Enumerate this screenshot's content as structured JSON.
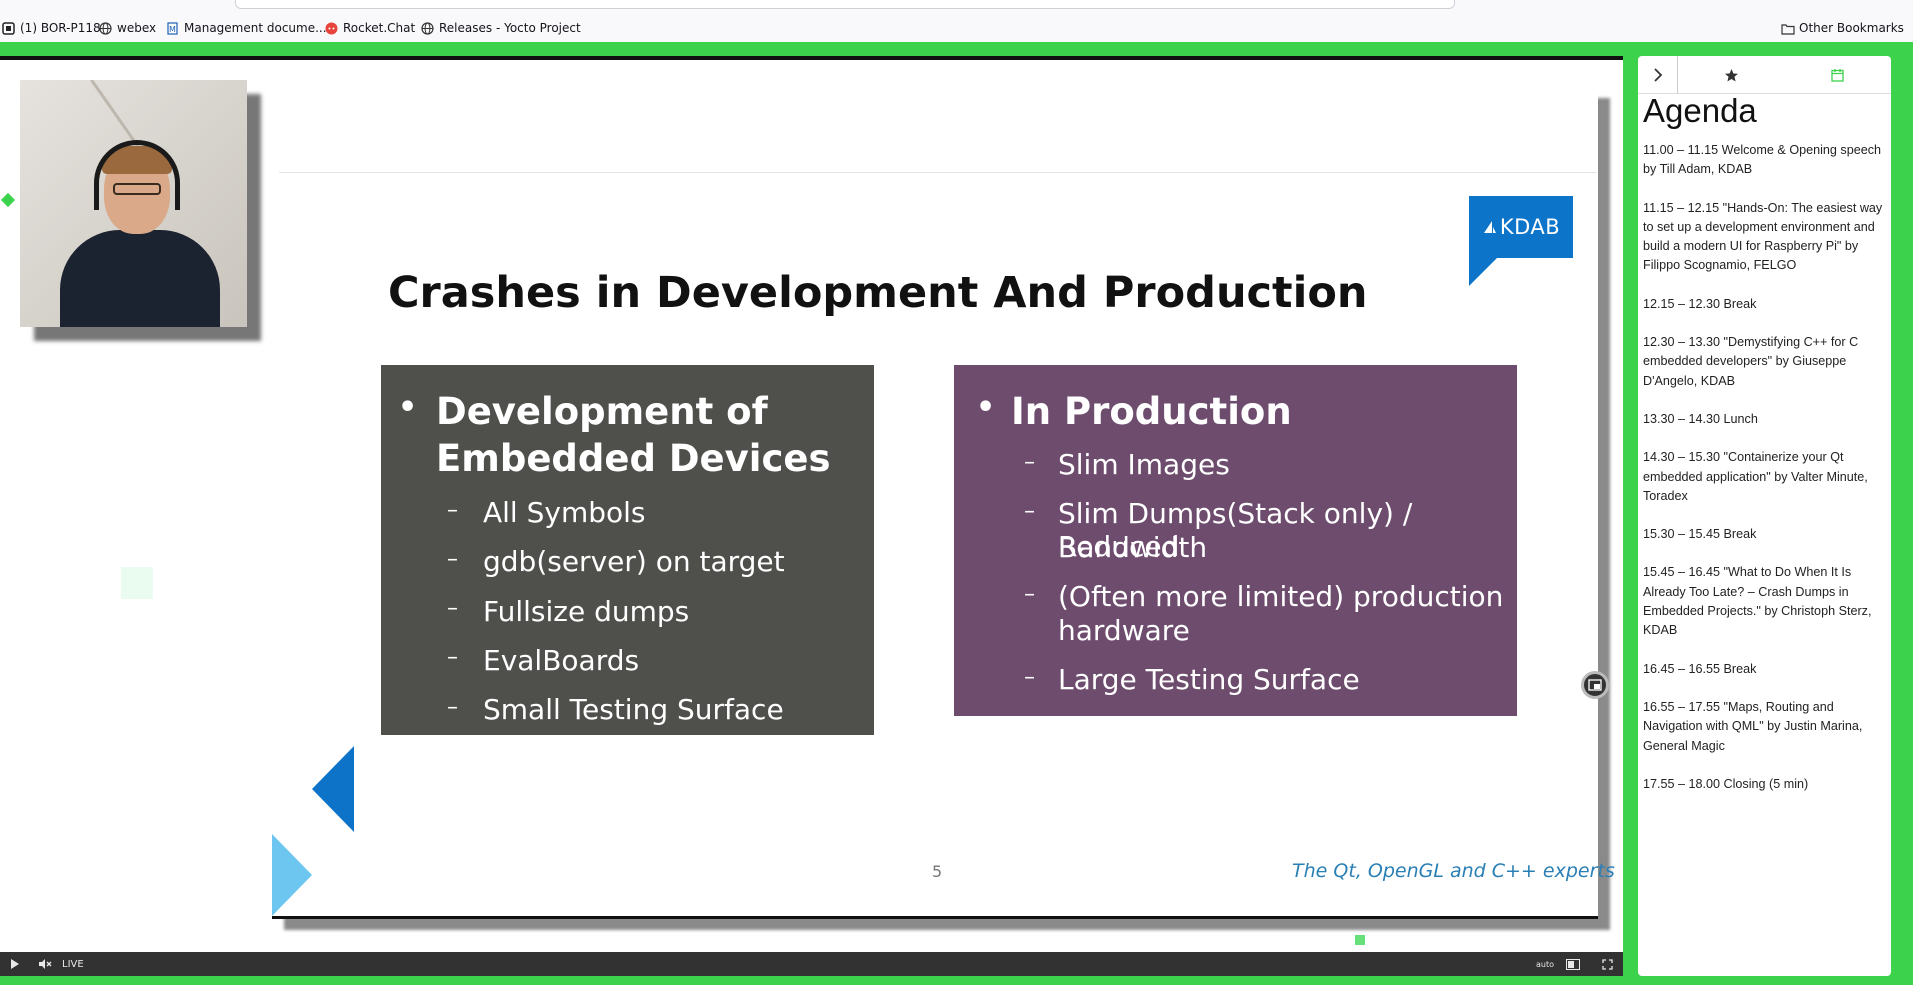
{
  "browser": {
    "bookmarks": [
      {
        "label": "(1) BOR-P118",
        "icon": "tab-icon"
      },
      {
        "label": "webex",
        "icon": "globe-icon"
      },
      {
        "label": "Management docume...",
        "icon": "document-icon"
      },
      {
        "label": "Rocket.Chat",
        "icon": "rocketchat-icon"
      },
      {
        "label": "Releases - Yocto Project",
        "icon": "globe-icon"
      }
    ],
    "other_bookmarks": "Other Bookmarks"
  },
  "slide": {
    "logo": "KDAB",
    "title": "Crashes in Development And Production",
    "left_box": {
      "heading_line1": "Development of",
      "heading_line2": "Embedded Devices",
      "items": [
        "All Symbols",
        "gdb(server) on target",
        "Fullsize dumps",
        "EvalBoards",
        "Small Testing Surface"
      ]
    },
    "right_box": {
      "heading": "In Production",
      "items": [
        {
          "line1": "Slim Images",
          "line2": ""
        },
        {
          "line1": "Slim Dumps(Stack only)  / Reduced",
          "line2": "Bandwidth"
        },
        {
          "line1": "(Often more limited) production",
          "line2": "hardware"
        },
        {
          "line1": "Large Testing Surface",
          "line2": ""
        }
      ]
    },
    "bullet": "•",
    "dash": "–",
    "page_number": "5",
    "tagline": "The Qt, OpenGL and C++ experts"
  },
  "player": {
    "live_label": "LIVE",
    "quality_label": "auto"
  },
  "panel": {
    "title": "Agenda",
    "items": [
      "11.00 – 11.15 Welcome & Opening speech by Till Adam, KDAB",
      "11.15 – 12.15 \"Hands-On: The easiest way to set up a development environment and build a modern UI for Raspberry Pi\" by Filippo Scognamio, FELGO",
      "12.15 – 12.30 Break",
      "12.30 – 13.30 \"Demystifying C++ for C embedded developers\" by Giuseppe D'Angelo, KDAB",
      "13.30 – 14.30 Lunch",
      "14.30 – 15.30 \"Containerize your Qt embedded application\" by Valter Minute, Toradex",
      "15.30 – 15.45 Break",
      "15.45 – 16.45 \"What to Do When It Is Already Too Late? – Crash Dumps in Embedded Projects.\" by Christoph Sterz, KDAB",
      "16.45 – 16.55 Break",
      "16.55 – 17.55 \"Maps, Routing and Navigation with QML\" by Justin Marina, General Magic",
      "17.55 – 18.00 Closing (5 min)"
    ]
  },
  "colors": {
    "frame_green": "#3cd24b",
    "kdab_blue": "#0c74c9",
    "left_box": "#4f504c",
    "right_box": "#6e4c6e",
    "tagline_blue": "#2a7fb5"
  }
}
